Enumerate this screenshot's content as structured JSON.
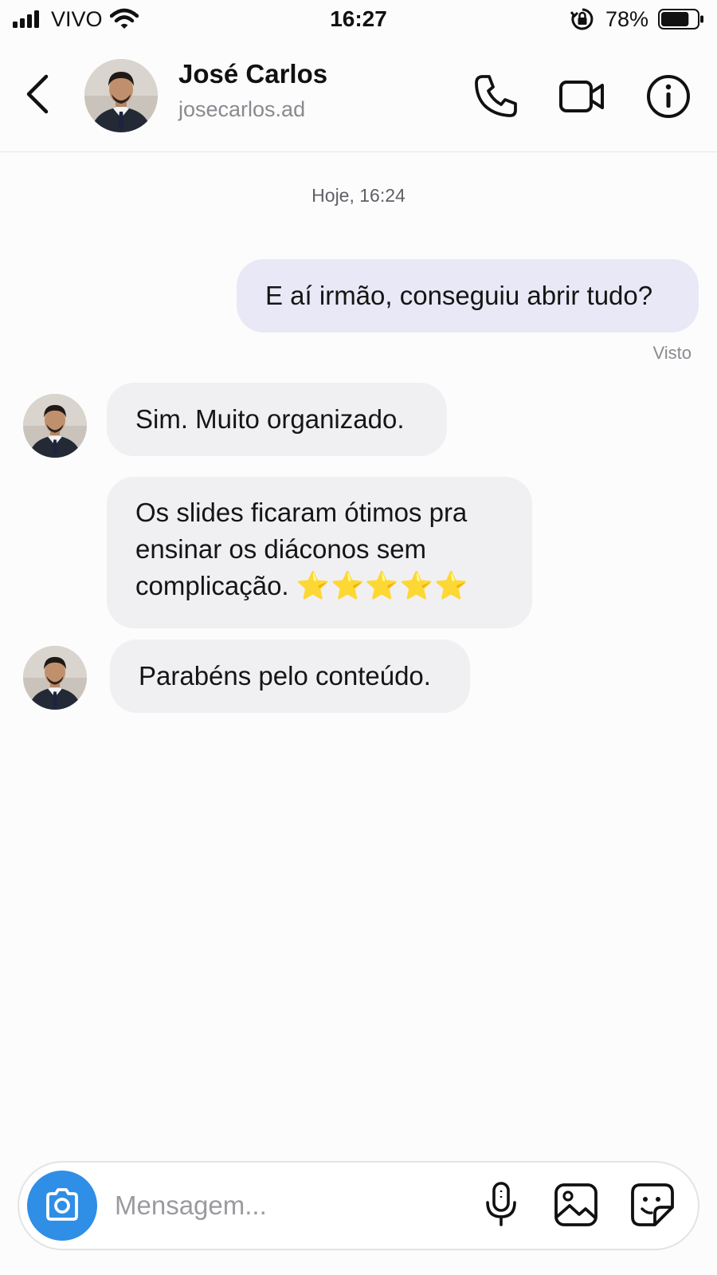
{
  "status_bar": {
    "carrier": "VIVO",
    "time": "16:27",
    "battery": "78%",
    "battery_level": 0.78
  },
  "header": {
    "contact_name": "José Carlos",
    "username": "josecarlos.ad"
  },
  "chat": {
    "timestamp": "Hoje, 16:24",
    "messages": [
      {
        "direction": "out",
        "text": "E aí irmão, conseguiu abrir tudo?"
      },
      {
        "direction": "in",
        "text": "Sim. Muito organizado."
      },
      {
        "direction": "in",
        "text": "Os slides ficaram ótimos pra ensinar os diáconos sem complicação.",
        "emoji": "⭐⭐⭐⭐⭐"
      },
      {
        "direction": "in",
        "text": "Parabéns pelo conteúdo."
      }
    ],
    "seen_label": "Visto"
  },
  "composer": {
    "placeholder": "Mensagem...",
    "value": ""
  },
  "colors": {
    "outgoing_bubble": "#e9e8f6",
    "incoming_bubble": "#f0f0f2",
    "camera_button": "#2f8ee6",
    "star": "#f6b820"
  },
  "icons": [
    "signal-icon",
    "wifi-icon",
    "rotation-lock-icon",
    "battery-icon",
    "back-icon",
    "phone-icon",
    "video-icon",
    "info-icon",
    "camera-icon",
    "microphone-icon",
    "image-icon",
    "sticker-icon"
  ]
}
